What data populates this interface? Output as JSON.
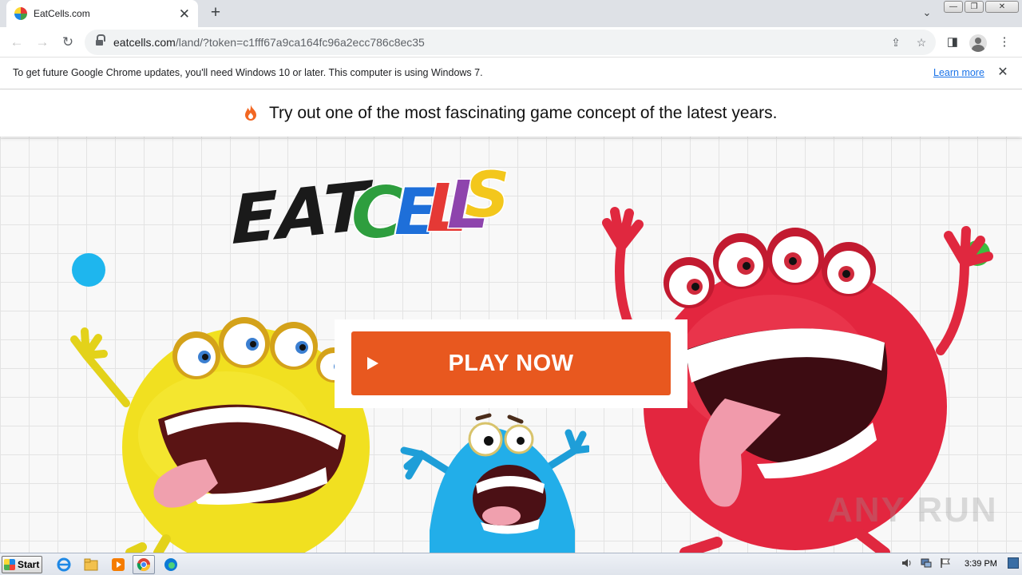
{
  "browser": {
    "tab": {
      "title": "EatCells.com",
      "close": "✕"
    },
    "new_tab": "+",
    "tab_search": "⌄",
    "window_controls": {
      "minimize": "—",
      "restore": "❐",
      "close": "✕"
    },
    "nav": {
      "back": "←",
      "forward": "→",
      "reload": "↻"
    },
    "url": {
      "host": "eatcells.com",
      "path": "/land/?token=c1fff67a9ca164fc96a2ecc786c8ec35"
    },
    "toolbar_icons": {
      "share": "⇪",
      "bookmark": "☆",
      "side_panel": "◨",
      "menu": "⋮"
    }
  },
  "infobar": {
    "message": "To get future Google Chrome updates, you'll need Windows 10 or later. This computer is using Windows 7.",
    "link": "Learn more",
    "close": "✕"
  },
  "page": {
    "headline": "Try out one of the most fascinating game concept of the latest years.",
    "logo": {
      "word1": "EAT",
      "word2_letters": [
        "C",
        "E",
        "L",
        "L",
        "S"
      ]
    },
    "play_button": "PLAY NOW",
    "watermark": "ANY RUN",
    "colors": {
      "play": "#e8581f",
      "cell_c": "#2e9e3e",
      "cell_e": "#1e6fd9",
      "cell_l1": "#e53935",
      "cell_l2": "#8e44ad",
      "cell_s": "#f3c71c"
    }
  },
  "taskbar": {
    "start": "Start",
    "clock": "3:39 PM"
  }
}
